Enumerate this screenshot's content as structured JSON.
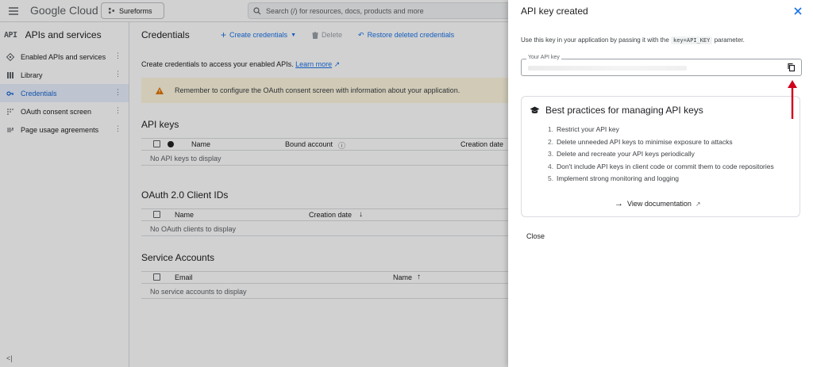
{
  "topbar": {
    "logo_google": "Google",
    "logo_cloud": "Cloud",
    "project": "Sureforms",
    "search_placeholder": "Search (/) for resources, docs, products and more"
  },
  "sidebar": {
    "api_tag": "API",
    "title": "APIs and services",
    "items": [
      {
        "label": "Enabled APIs and services",
        "icon": "api-diamond-icon"
      },
      {
        "label": "Library",
        "icon": "library-grid-icon"
      },
      {
        "label": "Credentials",
        "icon": "key-icon",
        "active": true
      },
      {
        "label": "OAuth consent screen",
        "icon": "oauth-grid-icon"
      },
      {
        "label": "Page usage agreements",
        "icon": "settings-list-icon"
      }
    ],
    "collapse": "<|"
  },
  "main": {
    "title": "Credentials",
    "actions": {
      "create": "Create credentials",
      "delete": "Delete",
      "restore": "Restore deleted credentials"
    },
    "intro_text": "Create credentials to access your enabled APIs.",
    "intro_link": "Learn more",
    "banner": "Remember to configure the OAuth consent screen with information about your application.",
    "api_keys": {
      "title": "API keys",
      "columns": [
        "Name",
        "Bound account",
        "Creation date"
      ],
      "empty": "No API keys to display"
    },
    "oauth": {
      "title": "OAuth 2.0 Client IDs",
      "columns": [
        "Name",
        "Creation date"
      ],
      "empty": "No OAuth clients to display"
    },
    "service": {
      "title": "Service Accounts",
      "columns": [
        "Email",
        "Name"
      ],
      "empty": "No service accounts to display"
    }
  },
  "panel": {
    "title": "API key created",
    "desc_before": "Use this key in your application by passing it with the",
    "desc_code": "key=API_KEY",
    "desc_after": "parameter.",
    "key_label": "Your API key",
    "best_practices": {
      "title": "Best practices for managing API keys",
      "items": [
        "Restrict your API key",
        "Delete unneeded API keys to minimise exposure to attacks",
        "Delete and recreate your API keys periodically",
        "Don't include API keys in client code or commit them to code repositories",
        "Implement strong monitoring and logging"
      ],
      "doc_link": "View documentation"
    },
    "close": "Close"
  },
  "colors": {
    "accent": "#1a73e8",
    "active_bg": "#e8f0fe",
    "warning_bg": "#fef7e0",
    "annotation_arrow": "#d0021b"
  }
}
